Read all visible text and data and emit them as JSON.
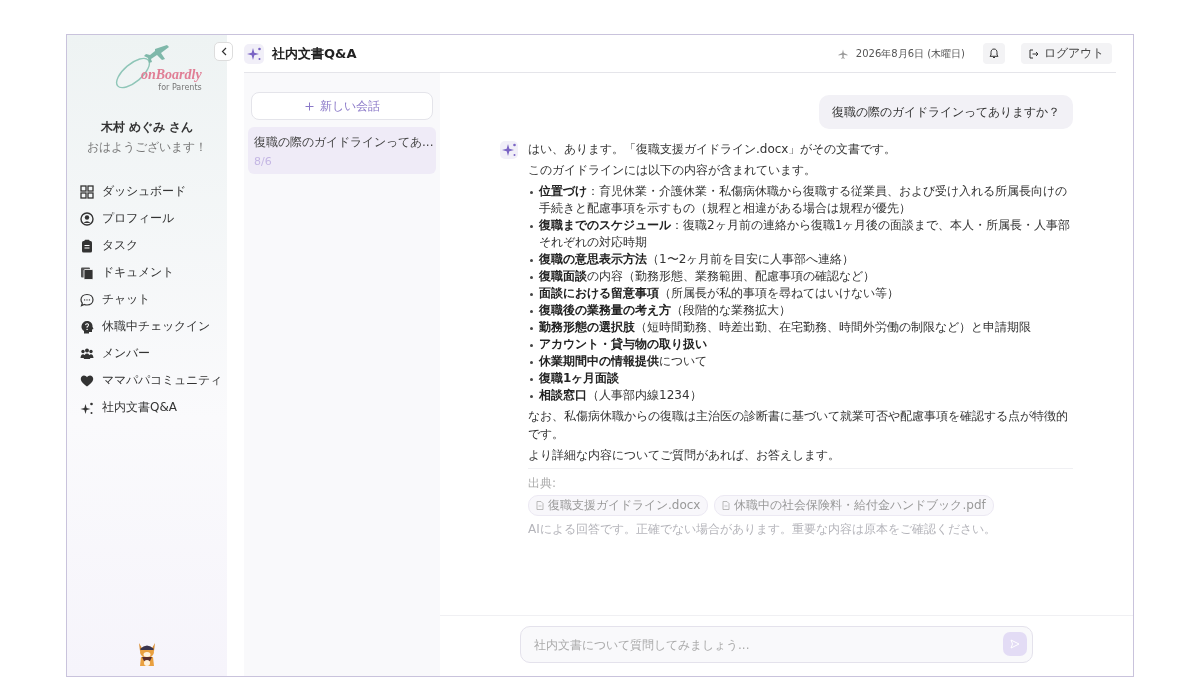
{
  "sidebar": {
    "logo": {
      "name": "onBoardly",
      "tagline": "for Parents"
    },
    "user": {
      "name": "木村 めぐみ さん",
      "greeting": "おはようございます！"
    },
    "items": [
      {
        "label": "ダッシュボード"
      },
      {
        "label": "プロフィール"
      },
      {
        "label": "タスク"
      },
      {
        "label": "ドキュメント"
      },
      {
        "label": "チャット"
      },
      {
        "label": "休職中チェックイン"
      },
      {
        "label": "メンバー"
      },
      {
        "label": "ママパパコミュニティ"
      },
      {
        "label": "社内文書Q&A"
      }
    ]
  },
  "header": {
    "title": "社内文書Q&A",
    "date": "2026年8月6日 (木曜日)",
    "logout": "ログアウト"
  },
  "conversations": {
    "new_button": "新しい会話",
    "items": [
      {
        "title": "復職の際のガイドラインってあ...",
        "date": "8/6",
        "selected": true
      }
    ]
  },
  "chat": {
    "messages": [
      {
        "kind": "user",
        "text": "復職の際のガイドラインってありますか？"
      },
      {
        "kind": "assistant",
        "intro": [
          "はい、あります。「復職支援ガイドライン.docx」がその文書です。",
          "このガイドラインには以下の内容が含まれています。"
        ],
        "bullets": [
          "**位置づけ**：育児休業・介護休業・私傷病休職から復職する従業員、および受け入れる所属長向けの手続きと配慮事項を示すもの（規程と相違がある場合は規程が優先）",
          "**復職までのスケジュール**：復職2ヶ月前の連絡から復職1ヶ月後の面談まで、本人・所属長・人事部それぞれの対応時期",
          "**復職の意思表示方法**（1〜2ヶ月前を目安に人事部へ連絡）",
          "**復職面談**の内容（勤務形態、業務範囲、配慮事項の確認など）",
          "**面談における留意事項**（所属長が私的事項を尋ねてはいけない等）",
          "**復職後の業務量の考え方**（段階的な業務拡大）",
          "**勤務形態の選択肢**（短時間勤務、時差出勤、在宅勤務、時間外労働の制限など）と申請期限",
          "**アカウント・貸与物の取り扱い**",
          "**休業期間中の情報提供**について",
          "**復職1ヶ月面談**",
          "**相談窓口**（人事部内線1234）"
        ],
        "outro": [
          "なお、私傷病休職からの復職は主治医の診断書に基づいて就業可否や配慮事項を確認する点が特徴的です。",
          "より詳細な内容についてご質問があれば、お答えします。"
        ],
        "sources_label": "出典:",
        "sources": [
          "復職支援ガイドライン.docx",
          "休職中の社会保険料・給付金ハンドブック.pdf"
        ],
        "disclaimer": "AIによる回答です。正確でない場合があります。重要な内容は原本をご確認ください。"
      }
    ],
    "input": {
      "placeholder": "社内文書について質問してみましょう..."
    }
  }
}
